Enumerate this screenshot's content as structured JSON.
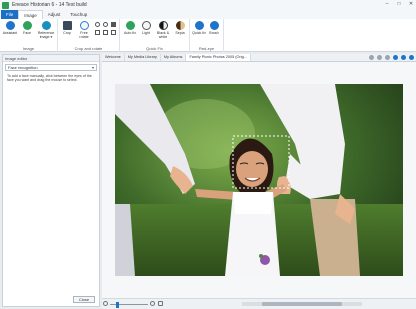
{
  "window": {
    "title": "Eneace Historian 6 - 14 Test build"
  },
  "ribbon_tabs": [
    "File",
    "Image",
    "Adjust",
    "Touchup"
  ],
  "ribbon": {
    "groups": [
      {
        "label": "Image",
        "buttons": [
          "Assistant",
          "Face",
          "Reference image ▾"
        ]
      },
      {
        "label": "Crop and rotate",
        "buttons": [
          "Crop",
          "Free rotate"
        ]
      },
      {
        "label": "Quick Fix",
        "buttons": [
          "Auto fix",
          "Light",
          "Black & white",
          "Sepia"
        ]
      },
      {
        "label": "Red-eye",
        "buttons": [
          "Quick fix",
          "Brush"
        ]
      }
    ],
    "colors": {
      "accent": "#1f74c8",
      "file_tab": "#1c6fc7"
    }
  },
  "left_panel": {
    "header": "Image editor",
    "tool_select": "Face recognition",
    "help_text": "To add a face manually, click between the eyes of the face you want and drag the mouse to select.",
    "close_label": "Close"
  },
  "doc_tabs": [
    "Welcome",
    "My Media Library",
    "My Albums",
    "Family Picnic Photos 2005 (Orig..."
  ],
  "status": {
    "zoom_fraction": 0.2
  }
}
